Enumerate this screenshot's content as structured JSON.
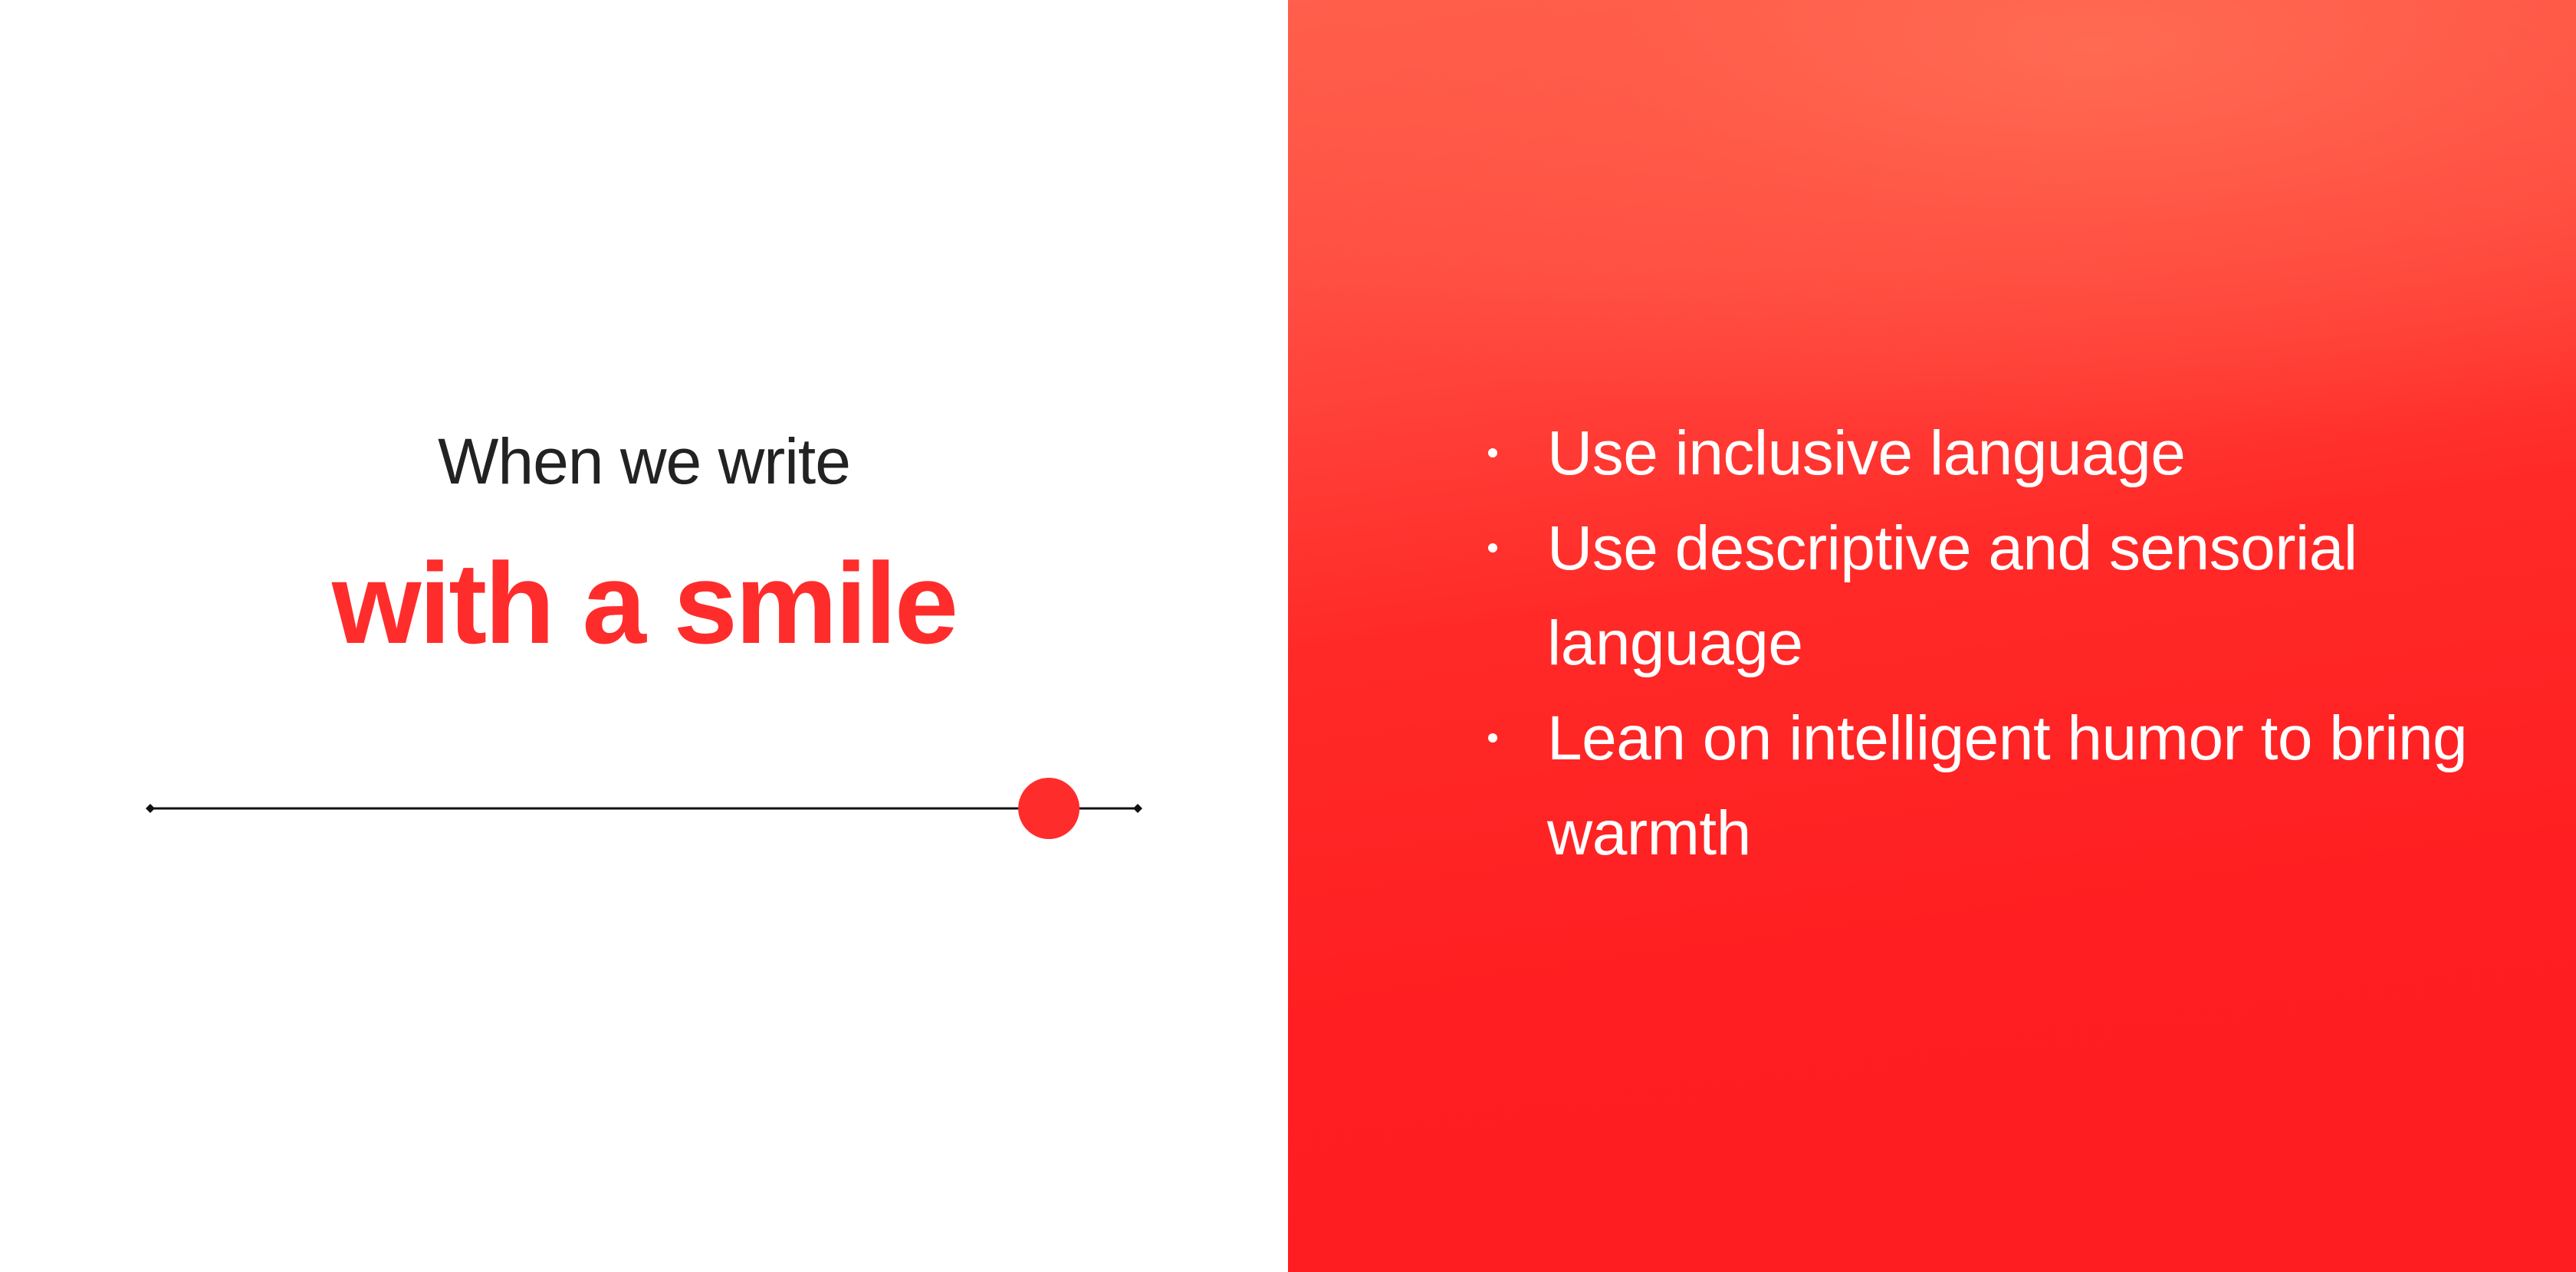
{
  "left": {
    "eyebrow": "When we write",
    "headline": "with a smile",
    "slider": {
      "value": 0.91,
      "accent_color": "#ff2c2c",
      "track_color": "#111111"
    }
  },
  "right": {
    "background_color": "#ff1f22",
    "bullets": [
      {
        "text": "Use inclusive language"
      },
      {
        "text": "Use descriptive and sensorial language"
      },
      {
        "text": "Lean on intelligent humor to bring warmth"
      }
    ]
  }
}
